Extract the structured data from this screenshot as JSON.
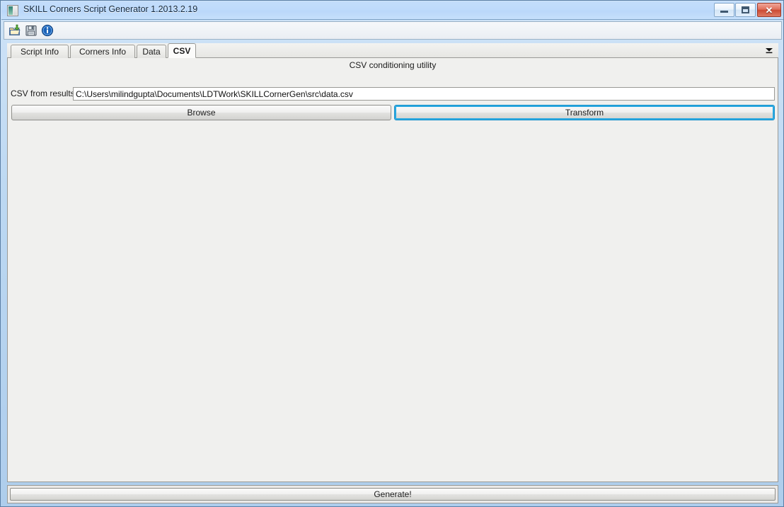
{
  "window": {
    "title": "SKILL Corners Script Generator 1.2013.2.19",
    "icon": "app-window-icon",
    "controls": {
      "minimize_label": "–",
      "maximize_label": "□",
      "close_label": "✕"
    },
    "frame_accent": "#aecdec",
    "titlebar_color": "#bedafb"
  },
  "toolbar": {
    "items": [
      {
        "name": "open-folder-icon",
        "tooltip": "Open"
      },
      {
        "name": "save-disk-icon",
        "tooltip": "Save"
      },
      {
        "name": "info-icon",
        "tooltip": "About"
      }
    ]
  },
  "tabs": {
    "items": [
      {
        "label": "Script Info",
        "active": false
      },
      {
        "label": "Corners Info",
        "active": false
      },
      {
        "label": "Data",
        "active": false
      },
      {
        "label": "CSV",
        "active": true
      }
    ],
    "overflow_icon": "chevron-down-icon"
  },
  "panel": {
    "section_title": "CSV conditioning utility",
    "path_field": {
      "label": "CSV from results:",
      "value": "C:\\Users\\milindgupta\\Documents\\LDTWork\\SKILLCornerGen\\src\\data.csv",
      "placeholder": ""
    },
    "browse_label": "Browse",
    "transform_label": "Transform",
    "focused_button": "Transform",
    "focus_ring_color": "#29a8e0"
  },
  "footer": {
    "generate_label": "Generate!"
  }
}
